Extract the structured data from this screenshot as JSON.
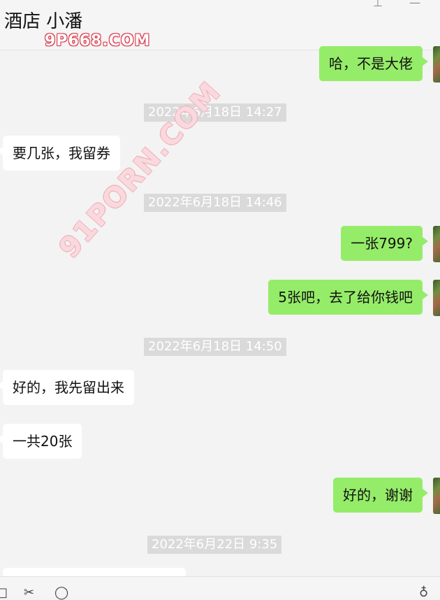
{
  "header": {
    "title": "酒店  小潘",
    "icons": [
      "pin-icon",
      "minimize-icon"
    ]
  },
  "watermarks": {
    "top": "9P668.COM",
    "diagonal": "91PORN.COM"
  },
  "messages": [
    {
      "side": "right",
      "text": "哈，不是大佬"
    },
    {
      "type": "timestamp",
      "text": "2022年6月18日 14:27"
    },
    {
      "side": "left",
      "text": "要几张，我留券"
    },
    {
      "type": "timestamp",
      "text": "2022年6月18日 14:46"
    },
    {
      "side": "right",
      "text": "一张799?"
    },
    {
      "side": "right",
      "text": "5张吧，去了给你钱吧"
    },
    {
      "type": "timestamp",
      "text": "2022年6月18日 14:50"
    },
    {
      "side": "left",
      "text": "好的，我先留出来"
    },
    {
      "side": "left",
      "text": "一共20张"
    },
    {
      "side": "right",
      "text": "好的，谢谢"
    },
    {
      "type": "timestamp",
      "text": "2022年6月22日 9:35"
    }
  ],
  "toolbar": {
    "icons": [
      "folder-icon",
      "scissors-icon",
      "emoji-icon",
      "microphone-icon"
    ]
  }
}
